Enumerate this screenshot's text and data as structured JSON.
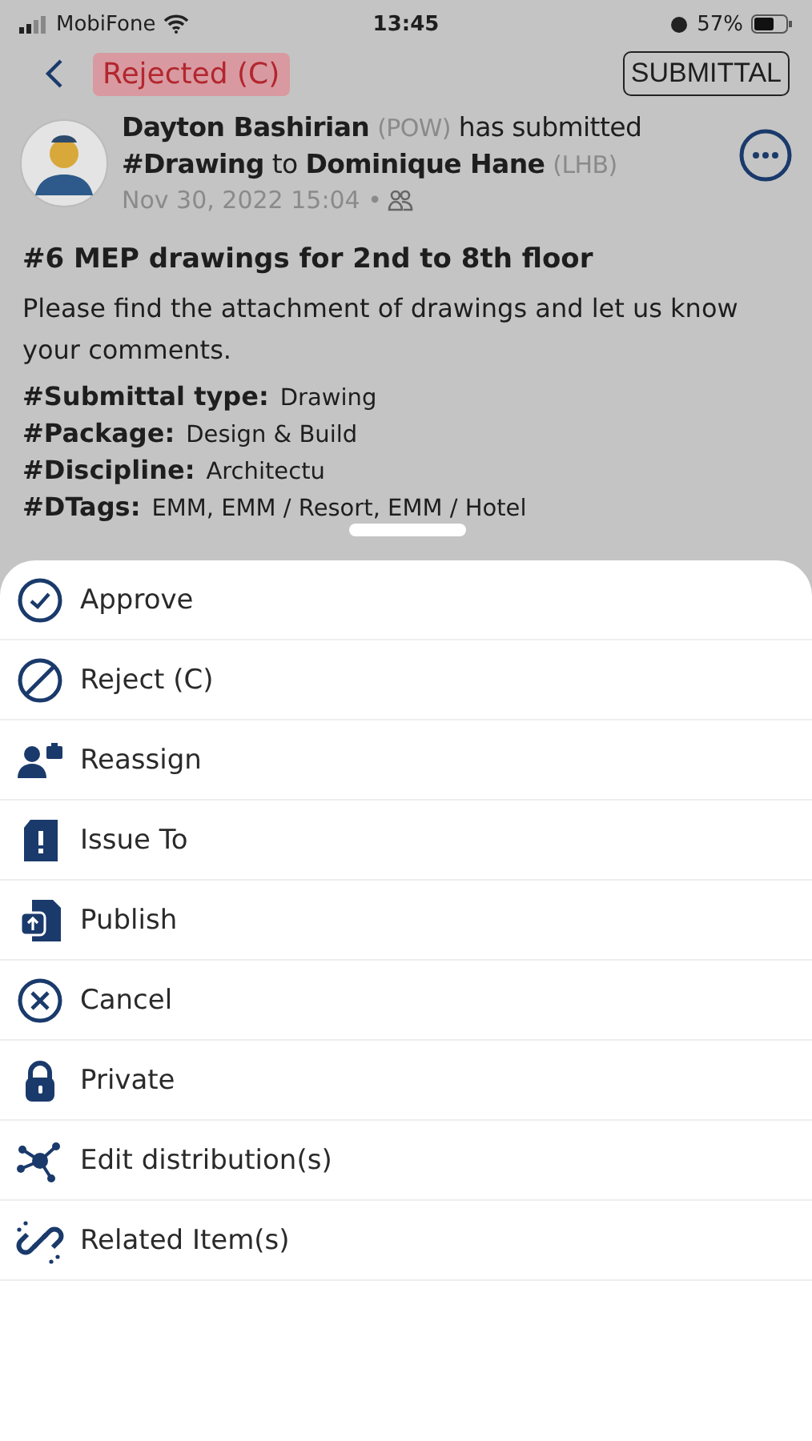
{
  "status_bar": {
    "carrier": "MobiFone",
    "time": "13:45",
    "battery": "57%"
  },
  "header": {
    "status": "Rejected (C)",
    "type": "SUBMITTAL"
  },
  "post": {
    "author": "Dayton Bashirian",
    "author_org": "(POW)",
    "verb": "has submitted",
    "item": "#Drawing",
    "to": "to",
    "recipient": "Dominique Hane",
    "recipient_org": "(LHB)",
    "date": "Nov 30, 2022 15:04",
    "separator": "•"
  },
  "title": "#6 MEP drawings for 2nd to 8th floor",
  "body": "Please find the attachment of drawings and let us know your comments.",
  "fields": [
    {
      "label": "#Submittal type:",
      "value": "Drawing"
    },
    {
      "label": "#Package:",
      "value": "Design & Build"
    },
    {
      "label": "#Discipline:",
      "value": "Architectu"
    },
    {
      "label": "#DTags:",
      "value": "EMM, EMM / Resort, EMM / Hotel"
    }
  ],
  "actions": [
    {
      "kind": "approve",
      "label": "Approve"
    },
    {
      "kind": "reject",
      "label": "Reject (C)"
    },
    {
      "kind": "reassign",
      "label": "Reassign"
    },
    {
      "kind": "issue",
      "label": "Issue To"
    },
    {
      "kind": "publish",
      "label": "Publish"
    },
    {
      "kind": "cancel",
      "label": "Cancel"
    },
    {
      "kind": "private",
      "label": "Private"
    },
    {
      "kind": "distribution",
      "label": "Edit distribution(s)"
    },
    {
      "kind": "related",
      "label": "Related Item(s)"
    }
  ]
}
